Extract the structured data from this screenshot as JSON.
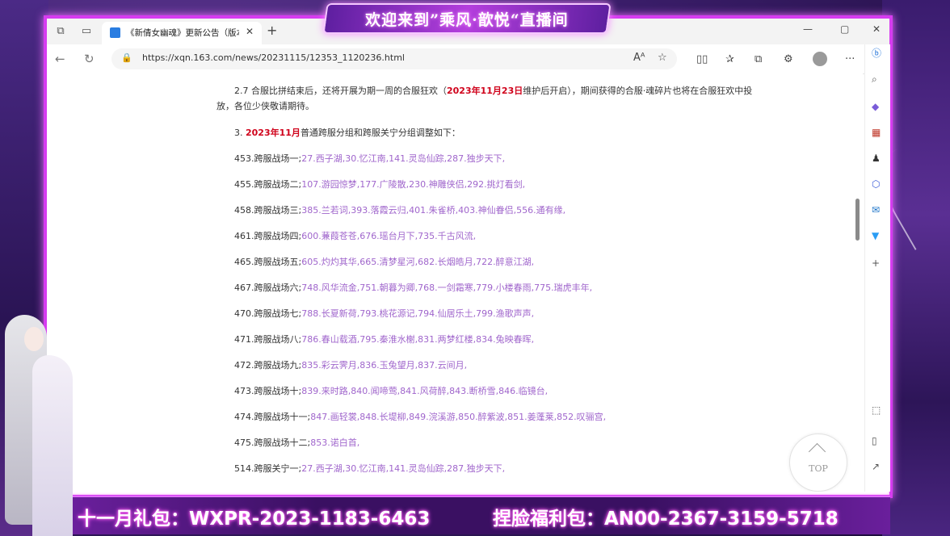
{
  "stream": {
    "banner": "欢迎来到”乘风·歆悦“直播间",
    "gift_left": "十一月礼包：WXPR-2023-1183-6463",
    "gift_right": "捏脸福利包：AN00-2367-3159-5718"
  },
  "browser": {
    "tab_title": "《新倩女幽魂》更新公告（版本...",
    "url": "https://xqn.163.com/news/20231115/12353_1120236.html",
    "top_label": "TOP"
  },
  "article": {
    "p1_a": "2.7 合服比拼结束后，还将开展为期一周的合服狂欢（",
    "p1_red": "2023年11月23日",
    "p1_b": "维护后开启），期间获得的合服·魂碎片也将在合服狂欢中投",
    "p1_c": "放，各位少侠敬请期待。",
    "p2_a": "3. ",
    "p2_red": "2023年11月",
    "p2_b": "普通跨服分组和跨服关宁分组调整如下：",
    "rows": [
      {
        "label": "453.跨服战场一;",
        "servers": "27.西子湖,30.忆江南,141.灵岛仙踪,287.独步天下,"
      },
      {
        "label": "455.跨服战场二;",
        "servers": "107.游园惊梦,177.广陵散,230.神雕侠侣,292.挑灯看剑,"
      },
      {
        "label": "458.跨服战场三;",
        "servers": "385.兰若词,393.落霞云归,401.朱雀桥,403.神仙眷侣,556.通有缘,"
      },
      {
        "label": "461.跨服战场四;",
        "servers": "600.蒹葭苍苍,676.瑶台月下,735.千古风流,"
      },
      {
        "label": "465.跨服战场五;",
        "servers": "605.灼灼其华,665.清梦星河,682.长烟皓月,722.醉意江湖,"
      },
      {
        "label": "467.跨服战场六;",
        "servers": "748.风华流金,751.朝暮为卿,768.一剑霜寒,779.小楼春雨,775.瑞虎丰年,"
      },
      {
        "label": "470.跨服战场七;",
        "servers": "788.长夏新荷,793.桃花源记,794.仙居乐土,799.渔歌声声,"
      },
      {
        "label": "471.跨服战场八;",
        "servers": "786.春山载酒,795.秦淮水榭,831.两梦红楼,834.兔映春晖,"
      },
      {
        "label": "472.跨服战场九;",
        "servers": "835.彩云霁月,836.玉兔望月,837.云间月,"
      },
      {
        "label": "473.跨服战场十;",
        "servers": "839.来时路,840.闻啼莺,841.风荷醉,843.断桥雪,846.临镜台,"
      },
      {
        "label": "474.跨服战场十一;",
        "servers": "847.画轻裳,848.长堤柳,849.浣溪游,850.醉紫波,851.姜蓬莱,852.叹骊宫,"
      },
      {
        "label": "475.跨服战场十二;",
        "servers": "853.诺白首,"
      },
      {
        "label": "514.跨服关宁一;",
        "servers": "27.西子湖,30.忆江南,141.灵岛仙踪,287.独步天下,"
      }
    ]
  }
}
